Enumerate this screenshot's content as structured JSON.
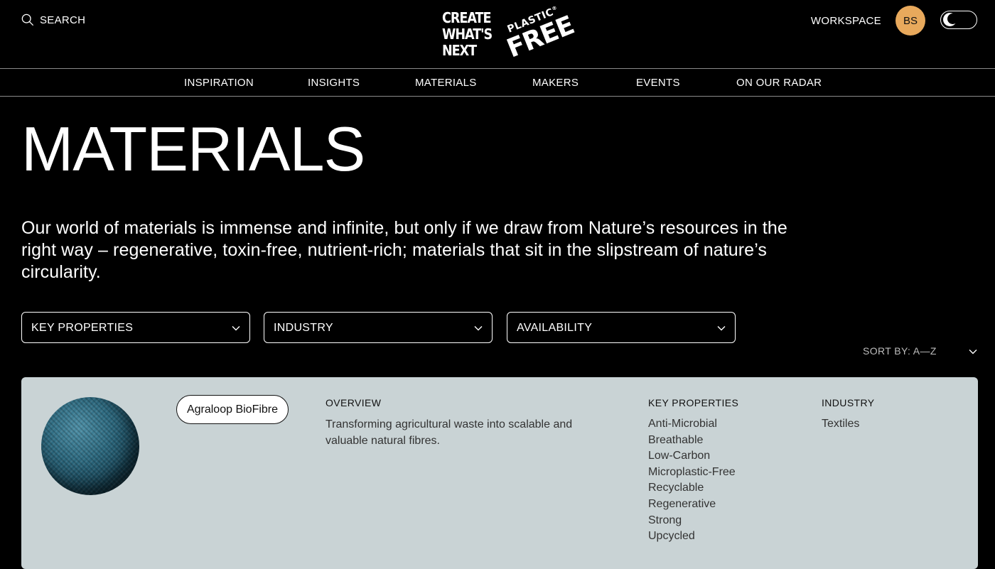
{
  "header": {
    "search_label": "SEARCH",
    "logo": {
      "lines": [
        "CREATE",
        "WHAT'S",
        "NEXT"
      ],
      "plastic": "PLASTIC",
      "free": "FREE",
      "registered": "®"
    },
    "workspace_label": "WORKSPACE",
    "avatar_initials": "BS",
    "avatar_color": "#e8a95c"
  },
  "nav": {
    "items": [
      "INSPIRATION",
      "INSIGHTS",
      "MATERIALS",
      "MAKERS",
      "EVENTS",
      "ON OUR RADAR"
    ]
  },
  "page": {
    "title": "MATERIALS",
    "intro": "Our world of materials is immense and infinite, but only if we draw from Nature’s resources in the right way – regenerative, toxin-free, nutrient-rich; materials that sit in the slipstream of nature’s circularity."
  },
  "filters": [
    {
      "label": "KEY PROPERTIES"
    },
    {
      "label": "INDUSTRY"
    },
    {
      "label": "AVAILABILITY"
    }
  ],
  "sort": {
    "label": "SORT BY: A—Z"
  },
  "materials": [
    {
      "name": "Agraloop BioFibre",
      "overview_heading": "OVERVIEW",
      "overview": "Transforming agricultural waste into scalable and valuable natural fibres.",
      "key_properties_heading": "KEY PROPERTIES",
      "key_properties": [
        "Anti-Microbial",
        "Breathable",
        "Low-Carbon",
        "Microplastic-Free",
        "Recyclable",
        "Regenerative",
        "Strong",
        "Upcycled"
      ],
      "industry_heading": "INDUSTRY",
      "industry": [
        "Textiles"
      ],
      "card_color": "#c9d3d5"
    }
  ]
}
